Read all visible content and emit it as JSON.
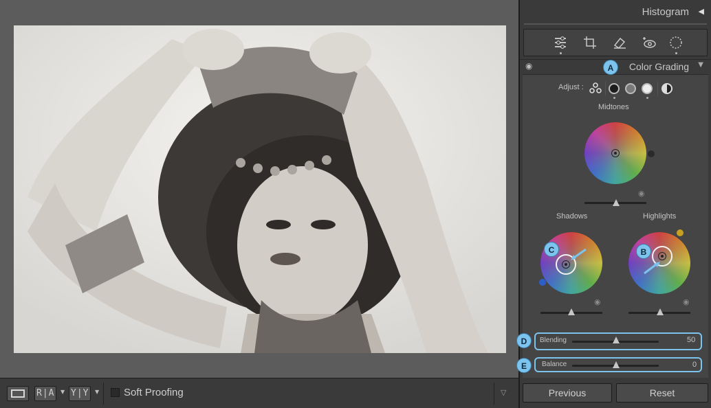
{
  "toolbar": {
    "view_compare_before": "R|A",
    "view_compare_after": "Y|Y",
    "soft_proofing_label": "Soft Proofing"
  },
  "panel": {
    "histogram_label": "Histogram",
    "section_title": "Color Grading",
    "adjust_label": "Adjust :",
    "midtones_label": "Midtones",
    "shadows_label": "Shadows",
    "highlights_label": "Highlights",
    "blending_label": "Blending",
    "blending_value": "50",
    "balance_label": "Balance",
    "balance_value": "0",
    "previous_label": "Previous",
    "reset_label": "Reset"
  },
  "callouts": {
    "a": "A",
    "b": "B",
    "c": "C",
    "d": "D",
    "e": "E"
  },
  "colors": {
    "callout": "#7cc3ee",
    "panel_bg": "#3a3a3a",
    "canvas_bg": "#5c5c5c"
  },
  "icons": [
    "edit-sliders-icon",
    "crop-icon",
    "healing-icon",
    "red-eye-icon",
    "masking-icon"
  ]
}
